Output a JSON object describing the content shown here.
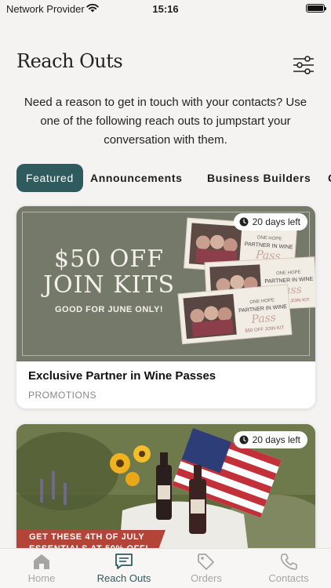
{
  "status_bar": {
    "provider": "Network Provider",
    "time": "15:16"
  },
  "header": {
    "title": "Reach Outs",
    "filter_icon": "sliders-icon"
  },
  "intro": "Need a reason to get in touch with your contacts? Use one of the following reach outs to jumpstart your conversation with them.",
  "tabs": [
    {
      "label": "Featured",
      "active": true
    },
    {
      "label": "Announcements",
      "active": false
    },
    {
      "label": "Business Builders",
      "active": false
    },
    {
      "label": "C",
      "active": false
    }
  ],
  "cards": [
    {
      "badge": "20 days left",
      "title": "Exclusive Partner in Wine Passes",
      "category": "PROMOTIONS",
      "promo": {
        "line1": "$50 OFF",
        "line2": "JOIN KITS",
        "sub": "GOOD FOR JUNE ONLY!",
        "ticket_top": "ONE HOPE",
        "ticket_title": "PARTNER IN WINE",
        "ticket_script": "Pass",
        "ticket_offer": "$50 OFF JOIN KIT"
      }
    },
    {
      "badge": "20 days left",
      "banner_text": "GET THESE 4TH OF JULY ESSENTIALS AT 50% OFF!"
    }
  ],
  "nav": [
    {
      "label": "Home",
      "icon": "home-icon",
      "active": false
    },
    {
      "label": "Reach Outs",
      "icon": "message-icon",
      "active": true
    },
    {
      "label": "Orders",
      "icon": "tag-icon",
      "active": false
    },
    {
      "label": "Contacts",
      "icon": "phone-icon",
      "active": false
    }
  ],
  "colors": {
    "accent": "#2f5a5e",
    "promo_bg": "#75796a",
    "banner_red": "#b34437",
    "nav_inactive": "#a5a5a5"
  }
}
